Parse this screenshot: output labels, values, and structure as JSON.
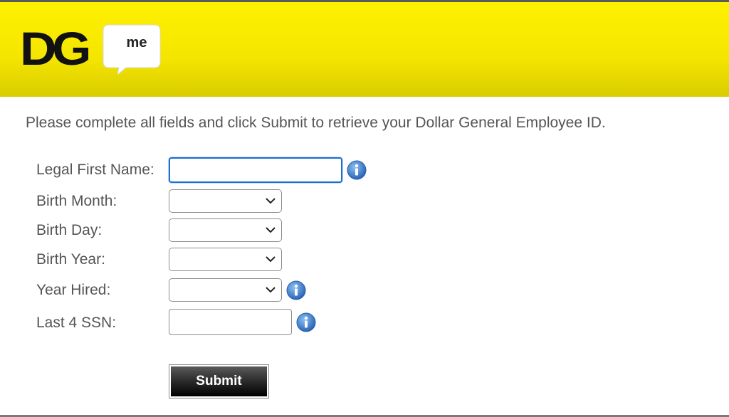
{
  "logo": {
    "brand_text": "DG",
    "bubble_text": "me"
  },
  "intro_text": "Please complete all fields and click Submit to retrieve your Dollar General Employee ID.",
  "form": {
    "first_name_label": "Legal First Name:",
    "first_name_value": "",
    "birth_month_label": "Birth Month:",
    "birth_month_value": "",
    "birth_day_label": "Birth Day:",
    "birth_day_value": "",
    "birth_year_label": "Birth Year:",
    "birth_year_value": "",
    "year_hired_label": "Year Hired:",
    "year_hired_value": "",
    "ssn_label": "Last 4 SSN:",
    "ssn_value": "",
    "submit_label": "Submit"
  },
  "colors": {
    "header_yellow": "#fff100",
    "focus_blue": "#1a6fd0",
    "info_blue": "#3a78c8",
    "label_gray": "#555555"
  },
  "icons": {
    "info": "info-icon",
    "dropdown": "chevron-down-icon"
  }
}
